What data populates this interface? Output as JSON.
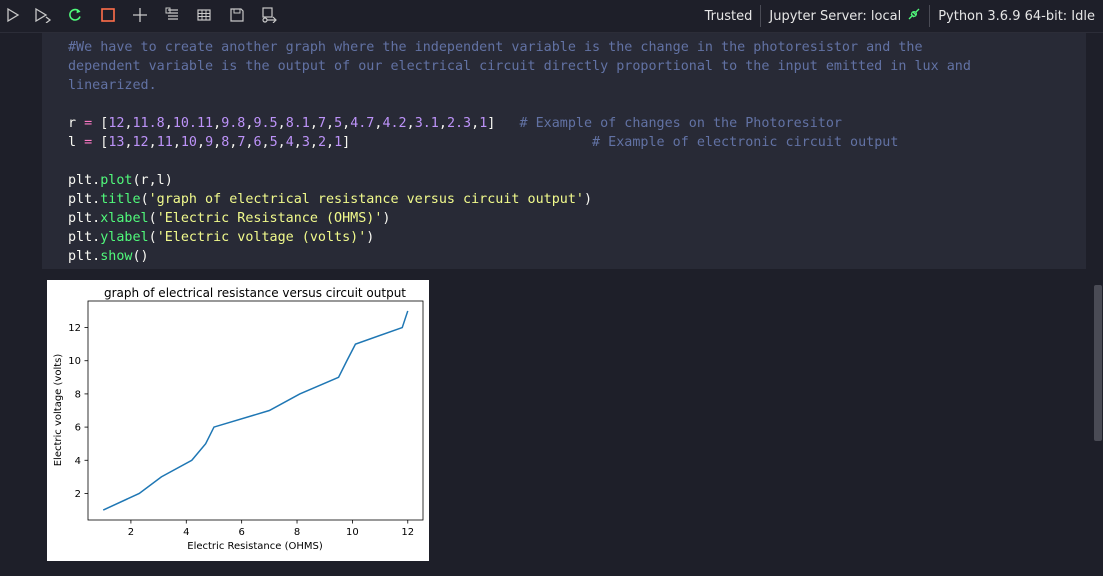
{
  "status": {
    "trusted": "Trusted",
    "server": "Jupyter Server: local",
    "kernel": "Python 3.6.9 64-bit: Idle"
  },
  "code_lines": [
    "#We have to create another graph where the independent variable is the change in the photoresistor and the",
    "dependent variable is the output of our electrical circuit directly proportional to the input emitted in lux and",
    "linearized.",
    "",
    "r = [12,11.8,10.11,9.8,9.5,8.1,7,5,4.7,4.2,3.1,2.3,1]   # Example of changes on the Photoresitor",
    "l = [13,12,11,10,9,8,7,6,5,4,3,2,1]                              # Example of electronic circuit output",
    "",
    "plt.plot(r,l)",
    "plt.title('graph of electrical resistance versus circuit output')",
    "plt.xlabel('Electric Resistance (OHMS)')",
    "plt.ylabel('Electric voltage (volts)')",
    "plt.show()"
  ],
  "colors": {
    "background": "#1e1f29",
    "cell": "#282a36",
    "line": "#1f77b4",
    "run_restart_icon": "#50fa7b",
    "interrupt_icon": "#ff6e4a"
  },
  "icons": [
    "run-cell-icon",
    "run-all-icon",
    "restart-icon",
    "interrupt-icon",
    "add-cell-icon",
    "clear-outputs-icon",
    "variables-icon",
    "save-icon",
    "export-icon",
    "plug-icon"
  ],
  "chart_data": {
    "type": "line",
    "title": "graph of electrical resistance versus circuit output",
    "xlabel": "Electric Resistance (OHMS)",
    "ylabel": "Electric voltage (volts)",
    "xlim": [
      0.45,
      12.55
    ],
    "ylim": [
      0.4,
      13.6
    ],
    "xticks": [
      2,
      4,
      6,
      8,
      10,
      12
    ],
    "yticks": [
      2,
      4,
      6,
      8,
      10,
      12
    ],
    "grid": false,
    "series": [
      {
        "x": [
          12,
          11.8,
          10.11,
          9.8,
          9.5,
          8.1,
          7,
          5,
          4.7,
          4.2,
          3.1,
          2.3,
          1
        ],
        "y": [
          13,
          12,
          11,
          10,
          9,
          8,
          7,
          6,
          5,
          4,
          3,
          2,
          1
        ]
      }
    ]
  }
}
